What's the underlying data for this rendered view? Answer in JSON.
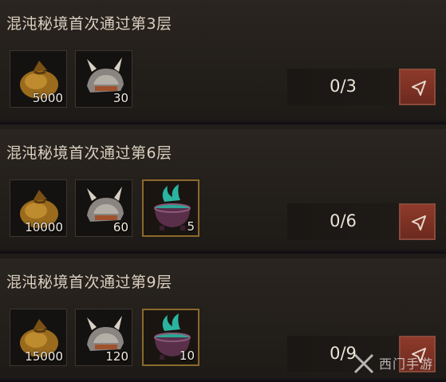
{
  "tasks": [
    {
      "title": "混沌秘境首次通过第3层",
      "progress": "0/3",
      "rewards": [
        {
          "icon": "gold-bag-icon",
          "qty": "5000"
        },
        {
          "icon": "helmet-icon",
          "qty": "30"
        }
      ]
    },
    {
      "title": "混沌秘境首次通过第6层",
      "progress": "0/6",
      "rewards": [
        {
          "icon": "gold-bag-icon",
          "qty": "10000"
        },
        {
          "icon": "helmet-icon",
          "qty": "60"
        },
        {
          "icon": "cauldron-icon",
          "qty": "5"
        }
      ]
    },
    {
      "title": "混沌秘境首次通过第9层",
      "progress": "0/9",
      "rewards": [
        {
          "icon": "gold-bag-icon",
          "qty": "15000"
        },
        {
          "icon": "helmet-icon",
          "qty": "120"
        },
        {
          "icon": "cauldron-icon",
          "qty": "10"
        }
      ]
    }
  ],
  "go_button_icon": "arrow-cursor-icon",
  "watermark": {
    "text": "西门手游",
    "icon": "x-logo-icon"
  },
  "colors": {
    "title_text": "#d9cfc0",
    "button_red": "#8e3a2a",
    "rare_frame": "#8a6a2c"
  }
}
